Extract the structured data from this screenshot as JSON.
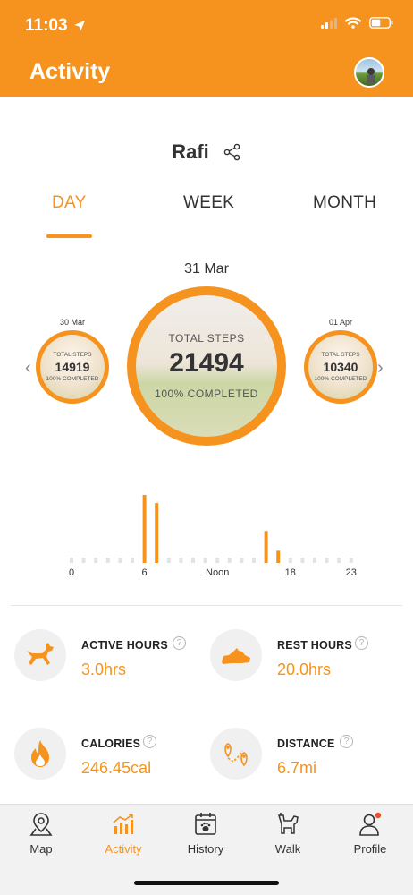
{
  "status_bar": {
    "time": "11:03"
  },
  "header": {
    "title": "Activity"
  },
  "dog": {
    "name": "Rafi"
  },
  "tabs": [
    {
      "label": "DAY",
      "active": true
    },
    {
      "label": "WEEK",
      "active": false
    },
    {
      "label": "MONTH",
      "active": false
    }
  ],
  "carousel": {
    "current": {
      "date": "31 Mar",
      "label": "TOTAL STEPS",
      "steps": "21494",
      "status": "100% COMPLETED"
    },
    "previous": {
      "date": "30 Mar",
      "label": "TOTAL STEPS",
      "steps": "14919",
      "status": "100% COMPLETED"
    },
    "next": {
      "date": "01 Apr",
      "label": "TOTAL STEPS",
      "steps": "10340",
      "status": "100% COMPLETED"
    }
  },
  "chart_data": {
    "type": "bar",
    "x": [
      0,
      1,
      2,
      3,
      4,
      5,
      6,
      7,
      8,
      9,
      10,
      11,
      12,
      13,
      14,
      15,
      16,
      17,
      18,
      19,
      20,
      21,
      22,
      23
    ],
    "tick_labels": [
      "0",
      "6",
      "Noon",
      "18",
      "23"
    ],
    "tick_positions": [
      0,
      6,
      12,
      18,
      23
    ],
    "values": [
      0,
      0,
      0,
      0,
      0,
      0,
      1.0,
      0.88,
      0,
      0,
      0,
      0,
      0,
      0,
      0,
      0,
      0.47,
      0.18,
      0,
      0,
      0,
      0,
      0,
      0
    ],
    "ylim": [
      0,
      1
    ],
    "colors": {
      "bar": "#F5931E",
      "empty": "#e3e3e3"
    }
  },
  "stats": {
    "active_hours": {
      "label": "ACTIVE HOURS",
      "value": "3.0hrs"
    },
    "rest_hours": {
      "label": "REST HOURS",
      "value": "20.0hrs"
    },
    "calories": {
      "label": "CALORIES",
      "value": "246.45cal"
    },
    "distance": {
      "label": "DISTANCE",
      "value": "6.7mi"
    }
  },
  "bottom_nav": [
    {
      "label": "Map",
      "icon": "map-pin-icon",
      "active": false
    },
    {
      "label": "Activity",
      "icon": "activity-chart-icon",
      "active": true
    },
    {
      "label": "History",
      "icon": "calendar-paw-icon",
      "active": false
    },
    {
      "label": "Walk",
      "icon": "dog-walk-icon",
      "active": false
    },
    {
      "label": "Profile",
      "icon": "person-icon",
      "active": false
    }
  ],
  "colors": {
    "accent": "#F5931E",
    "notification": "#E8502E"
  }
}
